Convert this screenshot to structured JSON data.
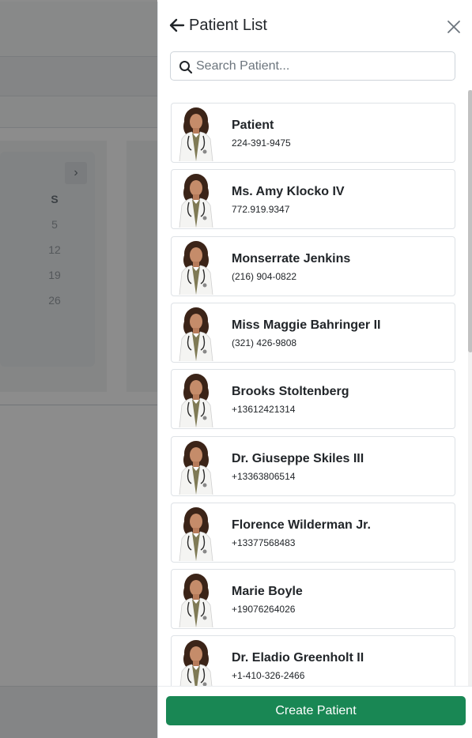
{
  "background": {
    "calendar": {
      "next_arrow": "›",
      "day_header": "S",
      "days": [
        "5",
        "12",
        "19",
        "26"
      ]
    }
  },
  "drawer": {
    "title": "Patient List",
    "search": {
      "placeholder": "Search Patient...",
      "value": ""
    },
    "patients": [
      {
        "name": "Patient",
        "phone": "224-391-9475"
      },
      {
        "name": "Ms. Amy Klocko IV",
        "phone": "772.919.9347"
      },
      {
        "name": "Monserrate Jenkins",
        "phone": "(216) 904-0822"
      },
      {
        "name": "Miss Maggie Bahringer II",
        "phone": "(321) 426-9808"
      },
      {
        "name": "Brooks Stoltenberg",
        "phone": "+13612421314"
      },
      {
        "name": "Dr. Giuseppe Skiles III",
        "phone": "+13363806514"
      },
      {
        "name": "Florence Wilderman Jr.",
        "phone": "+13377568483"
      },
      {
        "name": "Marie Boyle",
        "phone": "+19076264026"
      },
      {
        "name": "Dr. Eladio Greenholt II",
        "phone": "+1-410-326-2466"
      }
    ],
    "create_label": "Create Patient"
  },
  "colors": {
    "primary_button": "#198754",
    "overlay": "rgba(0,0,0,0.45)"
  },
  "icons": [
    "arrow-left-icon",
    "close-icon",
    "search-icon",
    "chevron-right-icon",
    "doctor-avatar"
  ]
}
